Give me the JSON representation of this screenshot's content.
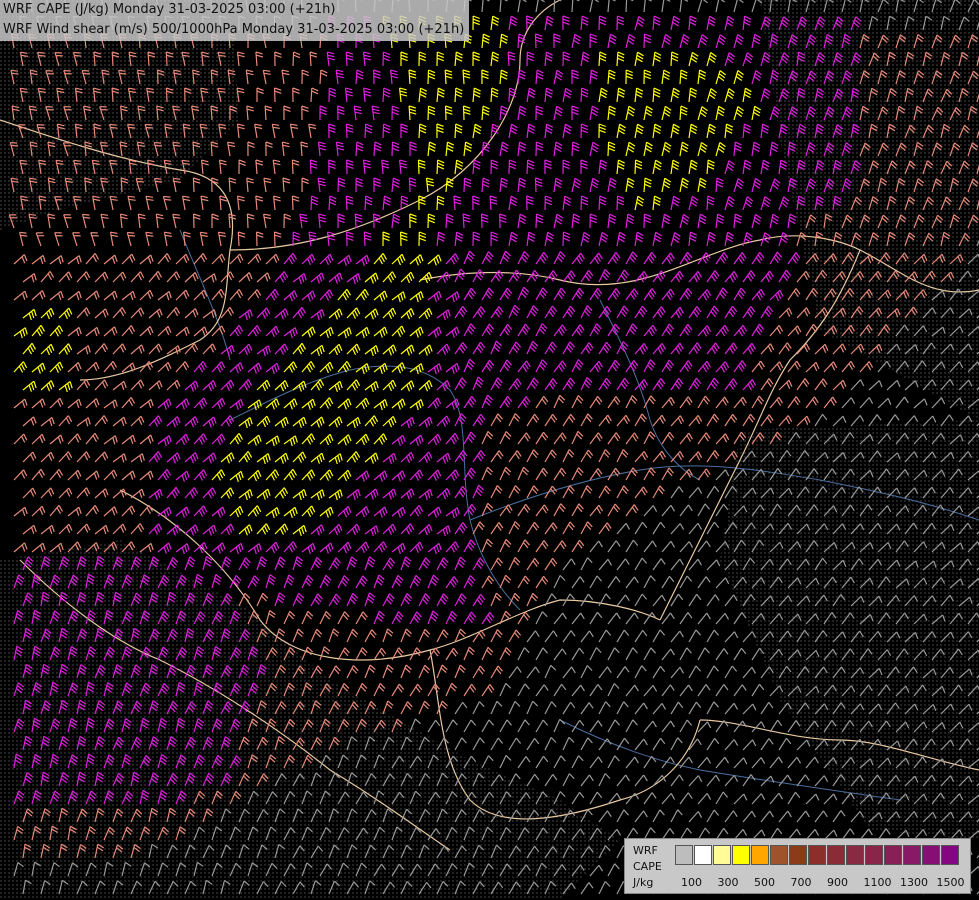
{
  "title": {
    "line1": "WRF CAPE (J/kg) Monday 31-03-2025 03:00 (+21h)",
    "line2": "WRF Wind shear (m/s) 500/1000hPa Monday 31-03-2025 03:00 (+21h)"
  },
  "legend": {
    "label_model": "WRF",
    "label_field": "CAPE",
    "label_unit": "J/kg",
    "colors": [
      "#bdbdbd",
      "#ffffff",
      "#fffb99",
      "#ffff00",
      "#ffa600",
      "#a0522d",
      "#8b3a1a",
      "#8b2f2a",
      "#8a2b35",
      "#8a2a40",
      "#8a254a",
      "#891f57",
      "#881966",
      "#870f73",
      "#860580"
    ],
    "ticks": [
      "100",
      "300",
      "500",
      "700",
      "900",
      "1100",
      "1300",
      "1500"
    ]
  },
  "barb_palette": {
    "gray": "#9a9a9a",
    "salmon": "#e88a7a",
    "magenta": "#e020e0",
    "yellow": "#ffff00",
    "border": "#e8c8a0",
    "river": "#4a6fa0"
  }
}
